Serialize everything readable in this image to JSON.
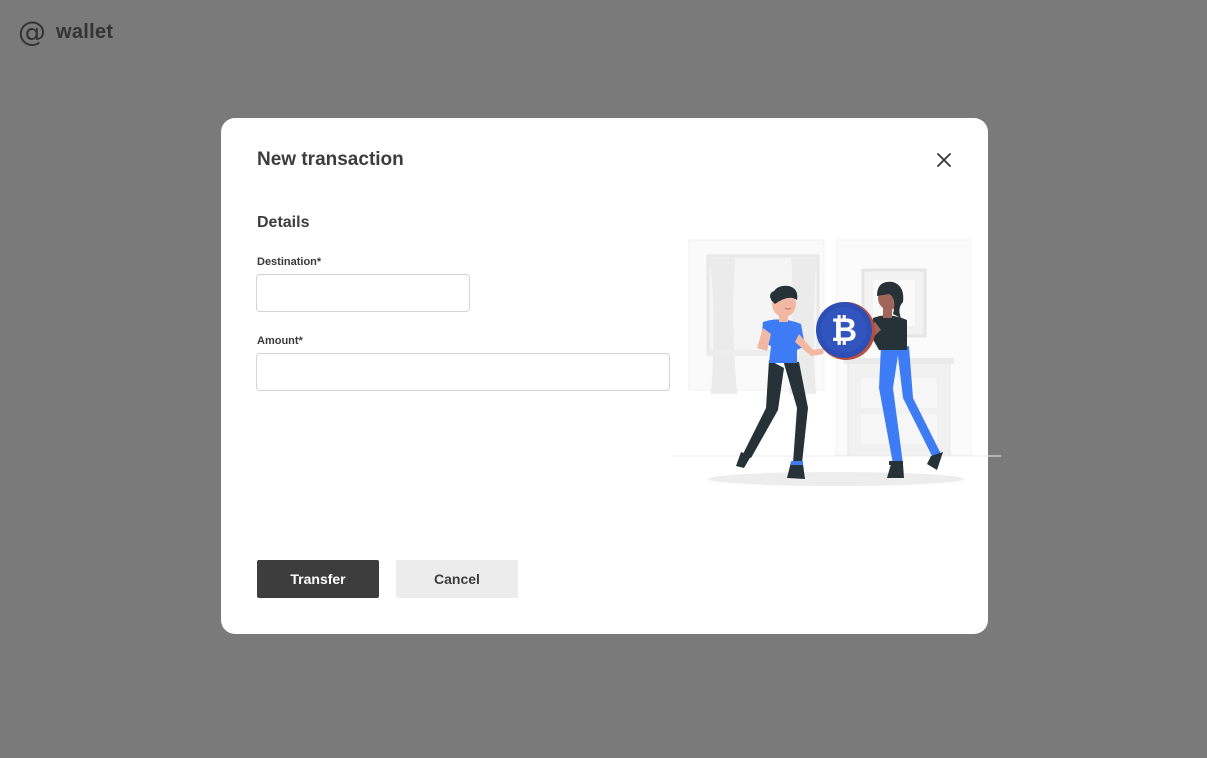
{
  "app": {
    "logo_symbol": "@",
    "logo_text": "wallet"
  },
  "modal": {
    "title": "New transaction",
    "close_icon": "close-icon",
    "section_title": "Details",
    "fields": {
      "destination": {
        "label": "Destination*",
        "value": "",
        "placeholder": ""
      },
      "amount": {
        "label": "Amount*",
        "value": "",
        "placeholder": ""
      }
    },
    "buttons": {
      "transfer_label": "Transfer",
      "cancel_label": "Cancel"
    },
    "illustration": {
      "coin_symbol": "bitcoin-icon"
    }
  },
  "colors": {
    "overlay": "rgba(0,0,0,0.52)",
    "primary_button": "#3d3d3d",
    "secondary_button": "#ececec",
    "accent_blue": "#3d7cf4",
    "coin_blue": "#2d4fb5"
  }
}
